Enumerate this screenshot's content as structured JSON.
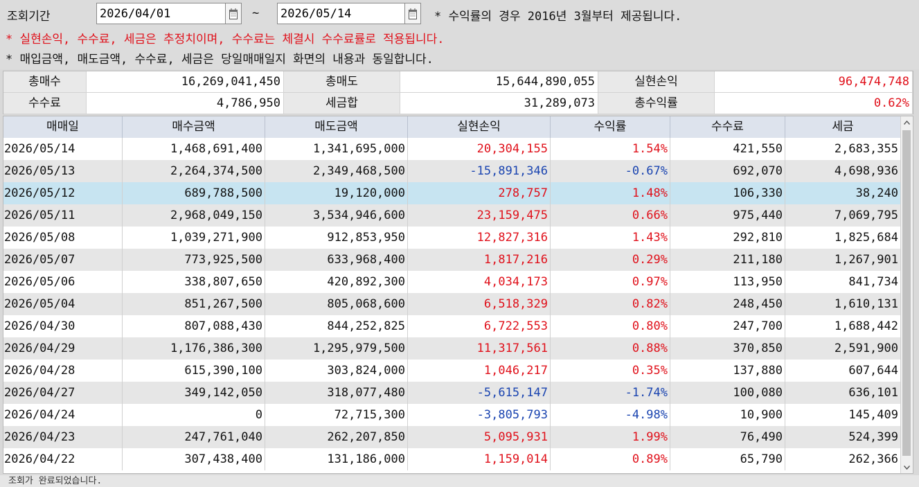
{
  "filter": {
    "period_label": "조회기간",
    "start_date": "2026/04/01",
    "end_date": "2026/05/14",
    "tilde": "~",
    "note1": "* 수익률의 경우 2016년 3월부터 제공됩니다.",
    "note2": "* 실현손익, 수수료, 세금은 추정치이며, 수수료는 체결시 수수료률로 적용됩니다.",
    "note3": "* 매입금액, 매도금액, 수수료, 세금은 당일매매일지 화면의 내용과 동일합니다."
  },
  "summary": {
    "total_buy_label": "총매수",
    "total_buy": "16,269,041,450",
    "total_sell_label": "총매도",
    "total_sell": "15,644,890,055",
    "realized_label": "실현손익",
    "realized": "96,474,748",
    "fee_label": "수수료",
    "fee": "4,786,950",
    "tax_label": "세금합",
    "tax": "31,289,073",
    "return_label": "총수익률",
    "return": "0.62%"
  },
  "colors": {
    "positive": "#e0101a",
    "negative": "#1a44b0",
    "selected_row": "#c7e4f1",
    "alt_row": "#e6e6e6"
  },
  "grid": {
    "columns": [
      "매매일",
      "매수금액",
      "매도금액",
      "실현손익",
      "수익률",
      "수수료",
      "세금"
    ],
    "rows": [
      {
        "date": "2026/05/14",
        "buy": "1,468,691,400",
        "sell": "1,341,695,000",
        "pnl": "20,304,155",
        "rate": "1.54%",
        "fee": "421,550",
        "tax": "2,683,355",
        "sign": "pos"
      },
      {
        "date": "2026/05/13",
        "buy": "2,264,374,500",
        "sell": "2,349,468,500",
        "pnl": "-15,891,346",
        "rate": "-0.67%",
        "fee": "692,070",
        "tax": "4,698,936",
        "sign": "neg"
      },
      {
        "date": "2026/05/12",
        "buy": "689,788,500",
        "sell": "19,120,000",
        "pnl": "278,757",
        "rate": "1.48%",
        "fee": "106,330",
        "tax": "38,240",
        "sign": "pos",
        "selected": true
      },
      {
        "date": "2026/05/11",
        "buy": "2,968,049,150",
        "sell": "3,534,946,600",
        "pnl": "23,159,475",
        "rate": "0.66%",
        "fee": "975,440",
        "tax": "7,069,795",
        "sign": "pos"
      },
      {
        "date": "2026/05/08",
        "buy": "1,039,271,900",
        "sell": "912,853,950",
        "pnl": "12,827,316",
        "rate": "1.43%",
        "fee": "292,810",
        "tax": "1,825,684",
        "sign": "pos"
      },
      {
        "date": "2026/05/07",
        "buy": "773,925,500",
        "sell": "633,968,400",
        "pnl": "1,817,216",
        "rate": "0.29%",
        "fee": "211,180",
        "tax": "1,267,901",
        "sign": "pos"
      },
      {
        "date": "2026/05/06",
        "buy": "338,807,650",
        "sell": "420,892,300",
        "pnl": "4,034,173",
        "rate": "0.97%",
        "fee": "113,950",
        "tax": "841,734",
        "sign": "pos"
      },
      {
        "date": "2026/05/04",
        "buy": "851,267,500",
        "sell": "805,068,600",
        "pnl": "6,518,329",
        "rate": "0.82%",
        "fee": "248,450",
        "tax": "1,610,131",
        "sign": "pos"
      },
      {
        "date": "2026/04/30",
        "buy": "807,088,430",
        "sell": "844,252,825",
        "pnl": "6,722,553",
        "rate": "0.80%",
        "fee": "247,700",
        "tax": "1,688,442",
        "sign": "pos"
      },
      {
        "date": "2026/04/29",
        "buy": "1,176,386,300",
        "sell": "1,295,979,500",
        "pnl": "11,317,561",
        "rate": "0.88%",
        "fee": "370,850",
        "tax": "2,591,900",
        "sign": "pos"
      },
      {
        "date": "2026/04/28",
        "buy": "615,390,100",
        "sell": "303,824,000",
        "pnl": "1,046,217",
        "rate": "0.35%",
        "fee": "137,880",
        "tax": "607,644",
        "sign": "pos"
      },
      {
        "date": "2026/04/27",
        "buy": "349,142,050",
        "sell": "318,077,480",
        "pnl": "-5,615,147",
        "rate": "-1.74%",
        "fee": "100,080",
        "tax": "636,101",
        "sign": "neg"
      },
      {
        "date": "2026/04/24",
        "buy": "0",
        "sell": "72,715,300",
        "pnl": "-3,805,793",
        "rate": "-4.98%",
        "fee": "10,900",
        "tax": "145,409",
        "sign": "neg"
      },
      {
        "date": "2026/04/23",
        "buy": "247,761,040",
        "sell": "262,207,850",
        "pnl": "5,095,931",
        "rate": "1.99%",
        "fee": "76,490",
        "tax": "524,399",
        "sign": "pos"
      },
      {
        "date": "2026/04/22",
        "buy": "307,438,400",
        "sell": "131,186,000",
        "pnl": "1,159,014",
        "rate": "0.89%",
        "fee": "65,790",
        "tax": "262,366",
        "sign": "pos"
      }
    ]
  },
  "status": {
    "message": "조회가 완료되었습니다."
  }
}
